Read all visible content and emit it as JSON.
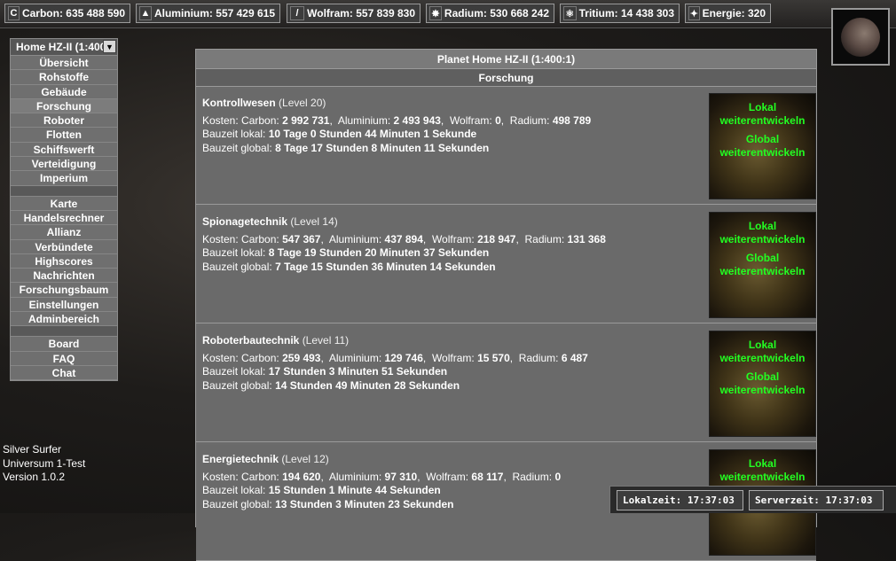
{
  "resources": [
    {
      "icon": "carbon-icon",
      "glyph": "C",
      "label": "Carbon: 635 488 590"
    },
    {
      "icon": "aluminium-icon",
      "glyph": "▲",
      "label": "Aluminium: 557 429 615"
    },
    {
      "icon": "wolfram-icon",
      "glyph": "/",
      "label": "Wolfram: 557 839 830"
    },
    {
      "icon": "radium-icon",
      "glyph": "✸",
      "label": "Radium: 530 668 242"
    },
    {
      "icon": "tritium-icon",
      "glyph": "⚛",
      "label": "Tritium: 14 438 303"
    },
    {
      "icon": "energie-icon",
      "glyph": "✦",
      "label": "Energie: 320"
    }
  ],
  "sidebar": {
    "planet_select": "Home HZ-II (1:400",
    "items_a": [
      "Übersicht",
      "Rohstoffe",
      "Gebäude",
      "Forschung",
      "Roboter",
      "Flotten",
      "Schiffswerft",
      "Verteidigung",
      "Imperium"
    ],
    "items_b": [
      "Karte",
      "Handelsrechner",
      "Allianz",
      "Verbündete",
      "Highscores",
      "Nachrichten",
      "Forschungsbaum",
      "Einstellungen",
      "Adminbereich"
    ],
    "items_c": [
      "Board",
      "FAQ",
      "Chat"
    ]
  },
  "main": {
    "title": "Planet Home HZ-II (1:400:1)",
    "subtitle": "Forschung",
    "labels": {
      "kosten": "Kosten:",
      "carbon": "Carbon:",
      "aluminium": "Aluminium:",
      "wolfram": "Wolfram:",
      "radium": "Radium:",
      "bauzeit_lokal": "Bauzeit lokal:",
      "bauzeit_global": "Bauzeit global:",
      "lokal_link": "Lokal weiterentwickeln",
      "global_link": "Global weiterentwickeln"
    },
    "research": [
      {
        "name": "Kontrollwesen",
        "level": "(Level 20)",
        "carbon": "2 992 731",
        "aluminium": "2 493 943",
        "wolfram": "0",
        "radium": "498 789",
        "lokal": "10 Tage 0 Stunden 44 Minuten 1 Sekunde",
        "global": "8 Tage 17 Stunden 8 Minuten 11 Sekunden"
      },
      {
        "name": "Spionagetechnik",
        "level": "(Level 14)",
        "carbon": "547 367",
        "aluminium": "437 894",
        "wolfram": "218 947",
        "radium": "131 368",
        "lokal": "8 Tage 19 Stunden 20 Minuten 37 Sekunden",
        "global": "7 Tage 15 Stunden 36 Minuten 14 Sekunden"
      },
      {
        "name": "Roboterbautechnik",
        "level": "(Level 11)",
        "carbon": "259 493",
        "aluminium": "129 746",
        "wolfram": "15 570",
        "radium": "6 487",
        "lokal": "17 Stunden 3 Minuten 51 Sekunden",
        "global": "14 Stunden 49 Minuten 28 Sekunden"
      },
      {
        "name": "Energietechnik",
        "level": "(Level 12)",
        "carbon": "194 620",
        "aluminium": "97 310",
        "wolfram": "68 117",
        "radium": "0",
        "lokal": "15 Stunden 1 Minute 44 Sekunden",
        "global": "13 Stunden 3 Minuten 23 Sekunden"
      }
    ]
  },
  "user": {
    "name": "Silver Surfer",
    "universe": "Universum 1-Test",
    "version": "Version 1.0.2"
  },
  "clocks": {
    "lokal": "Lokalzeit: 17:37:03",
    "server": "Serverzeit: 17:37:03"
  },
  "colors": {
    "link_green": "#22ff22",
    "panel_gray": "#6b6b6b"
  }
}
